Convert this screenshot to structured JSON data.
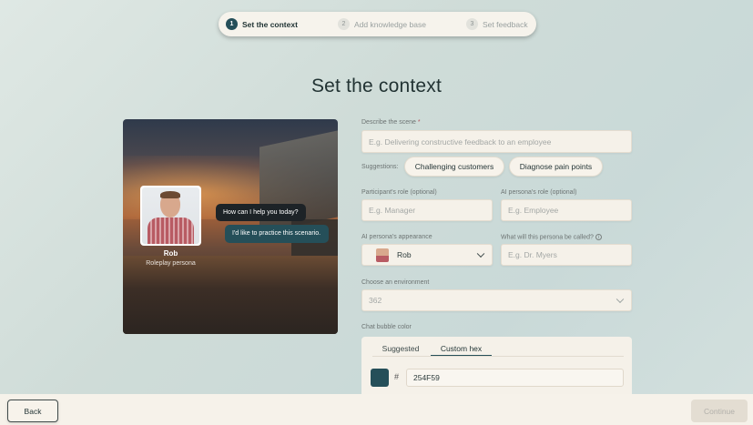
{
  "stepper": {
    "steps": [
      {
        "num": "1",
        "label": "Set the context"
      },
      {
        "num": "2",
        "label": "Add knowledge base"
      },
      {
        "num": "3",
        "label": "Set feedback"
      }
    ]
  },
  "page_title": "Set the context",
  "preview": {
    "persona_name": "Rob",
    "persona_role": "Roleplay persona",
    "ai_bubble": "How can I help you today?",
    "user_bubble": "I'd like to practice this scenario."
  },
  "form": {
    "scene_label": "Describe the scene",
    "scene_required": "*",
    "scene_placeholder": "E.g. Delivering constructive feedback to an employee",
    "suggestions_label": "Suggestions:",
    "suggestions": [
      "Challenging customers",
      "Diagnose pain points"
    ],
    "participant_role_label": "Participant's role (optional)",
    "participant_role_placeholder": "E.g. Manager",
    "ai_role_label": "AI persona's role (optional)",
    "ai_role_placeholder": "E.g. Employee",
    "appearance_label": "AI persona's appearance",
    "appearance_value": "Rob",
    "persona_called_label": "What will this persona be called?",
    "persona_called_placeholder": "E.g. Dr. Myers",
    "environment_label": "Choose an environment",
    "environment_value": "362",
    "bubble_color_label": "Chat bubble color",
    "tabs": [
      "Suggested",
      "Custom hex"
    ],
    "hash": "#",
    "hex_value": "254F59",
    "hex_color": "#254f59"
  },
  "footer": {
    "back_label": "Back",
    "continue_label": "Continue"
  },
  "colors": {
    "accent": "#254f59",
    "panel": "#f5f1e9"
  }
}
